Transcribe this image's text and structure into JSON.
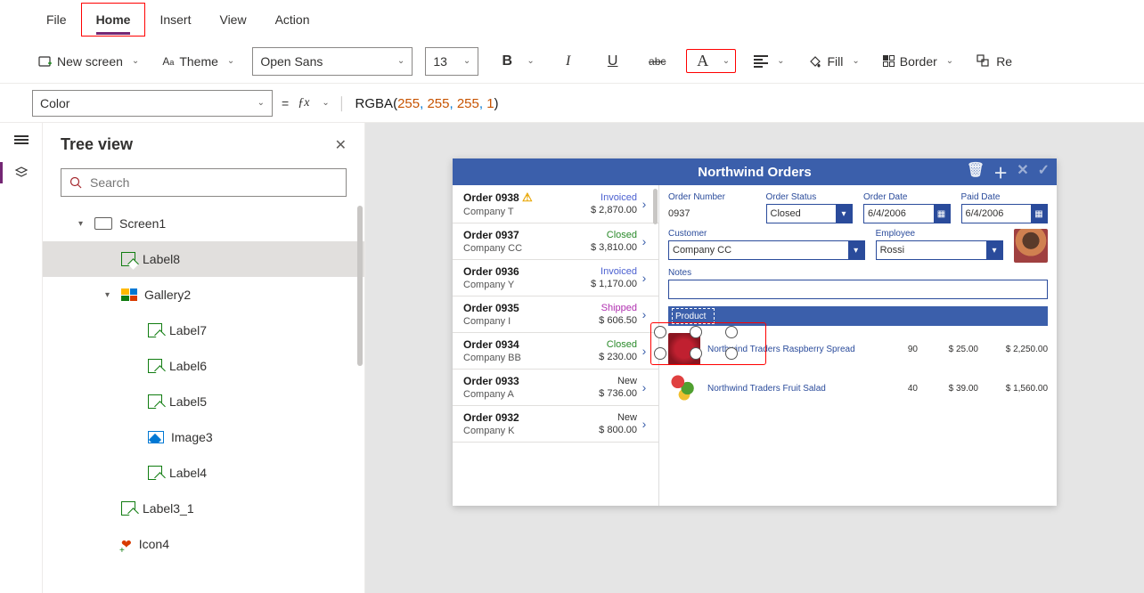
{
  "ribbon": {
    "tabs": [
      "File",
      "Home",
      "Insert",
      "View",
      "Action"
    ],
    "active_tab": "Home",
    "new_screen": "New screen",
    "theme": "Theme",
    "font_family": "Open Sans",
    "font_size": "13",
    "fill": "Fill",
    "border": "Border",
    "reorder_stub": "Re"
  },
  "formula": {
    "property": "Color",
    "fn": "RGBA",
    "args": [
      "255",
      "255",
      "255",
      "1"
    ]
  },
  "tree": {
    "title": "Tree view",
    "search_placeholder": "Search",
    "items": [
      {
        "depth": 1,
        "type": "screen",
        "label": "Screen1",
        "exp": "▾"
      },
      {
        "depth": 2,
        "type": "label",
        "label": "Label8",
        "selected": true
      },
      {
        "depth": 2,
        "type": "gallery",
        "label": "Gallery2",
        "exp": "▾"
      },
      {
        "depth": 3,
        "type": "label",
        "label": "Label7"
      },
      {
        "depth": 3,
        "type": "label",
        "label": "Label6"
      },
      {
        "depth": 3,
        "type": "label",
        "label": "Label5"
      },
      {
        "depth": 3,
        "type": "image",
        "label": "Image3"
      },
      {
        "depth": 3,
        "type": "label",
        "label": "Label4"
      },
      {
        "depth": 2,
        "type": "label",
        "label": "Label3_1"
      },
      {
        "depth": 2,
        "type": "icon4",
        "label": "Icon4"
      }
    ]
  },
  "app": {
    "title": "Northwind Orders",
    "orders": [
      {
        "id": "Order 0938",
        "company": "Company T",
        "status": "Invoiced",
        "status_cls": "st-invoiced",
        "amount": "$ 2,870.00",
        "warn": true
      },
      {
        "id": "Order 0937",
        "company": "Company CC",
        "status": "Closed",
        "status_cls": "st-closed",
        "amount": "$ 3,810.00"
      },
      {
        "id": "Order 0936",
        "company": "Company Y",
        "status": "Invoiced",
        "status_cls": "st-invoiced",
        "amount": "$ 1,170.00"
      },
      {
        "id": "Order 0935",
        "company": "Company I",
        "status": "Shipped",
        "status_cls": "st-shipped",
        "amount": "$ 606.50"
      },
      {
        "id": "Order 0934",
        "company": "Company BB",
        "status": "Closed",
        "status_cls": "st-closed",
        "amount": "$ 230.00"
      },
      {
        "id": "Order 0933",
        "company": "Company A",
        "status": "New",
        "status_cls": "st-new",
        "amount": "$ 736.00"
      },
      {
        "id": "Order 0932",
        "company": "Company K",
        "status": "New",
        "status_cls": "st-new",
        "amount": "$ 800.00"
      }
    ],
    "detail": {
      "labels": {
        "order_number": "Order Number",
        "order_status": "Order Status",
        "order_date": "Order Date",
        "paid_date": "Paid Date",
        "customer": "Customer",
        "employee": "Employee",
        "notes": "Notes",
        "product": "Product"
      },
      "order_number": "0937",
      "order_status": "Closed",
      "order_date": "6/4/2006",
      "paid_date": "6/4/2006",
      "customer": "Company CC",
      "employee": "Rossi",
      "line_items": [
        {
          "name": "Northwind Traders Raspberry Spread",
          "qty": "90",
          "price": "$ 25.00",
          "total": "$ 2,250.00",
          "cls": "jar"
        },
        {
          "name": "Northwind Traders Fruit Salad",
          "qty": "40",
          "price": "$ 39.00",
          "total": "$ 1,560.00",
          "cls": "salad"
        }
      ]
    }
  }
}
